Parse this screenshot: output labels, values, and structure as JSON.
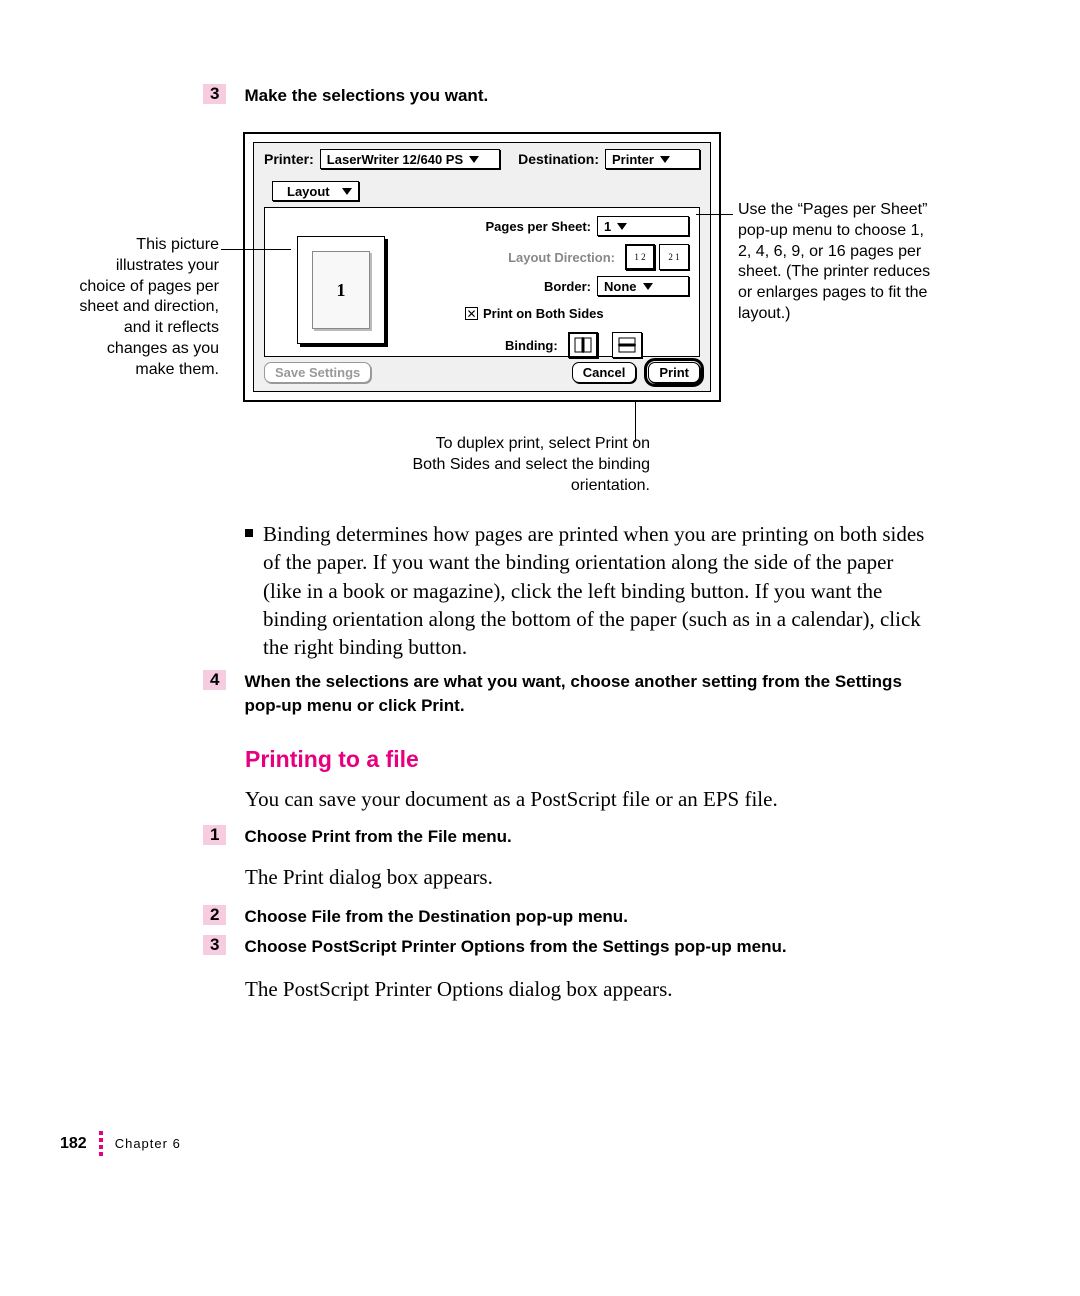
{
  "doc": {
    "page_number": "182",
    "chapter": "Chapter 6"
  },
  "steps_before": {
    "s3_num": "3",
    "s3_text": "Make the selections you want."
  },
  "dialog": {
    "printer_label": "Printer:",
    "printer_value": "LaserWriter 12/640 PS",
    "destination_label": "Destination:",
    "destination_value": "Printer",
    "tab": "Layout",
    "pps_label": "Pages per Sheet:",
    "pps_value": "1",
    "ld_label": "Layout Direction:",
    "ld_opt1": "1 2",
    "ld_opt2": "2 1",
    "border_label": "Border:",
    "border_value": "None",
    "both_label": "Print on Both Sides",
    "binding_label": "Binding:",
    "preview_text": "1",
    "save_btn": "Save Settings",
    "cancel_btn": "Cancel",
    "print_btn": "Print"
  },
  "callouts": {
    "left": "This picture illustrates your choice of pages per sheet and direction, and it reflects changes as you make them.",
    "right": "Use the “Pages per Sheet” pop-up menu to choose 1, 2, 4, 6, 9, or 16 pages per sheet. (The printer reduces or enlarges pages to fit the layout.)",
    "bottom": "To duplex print, select Print on Both Sides and select the binding orientation."
  },
  "body": {
    "binding_para": "Binding determines how pages are printed when you are printing on both sides of the paper. If you want the binding orientation along the side of the paper (like in a book or magazine), click the left binding button. If you want the binding orientation along the bottom of the paper (such as in a calendar), click the right binding button.",
    "s4_num": "4",
    "s4_text": "When the selections are what you want, choose another setting from the Settings pop-up menu or click Print.",
    "heading": "Printing to a file",
    "intro2": "You can save your document as a PostScript file or an EPS file.",
    "f1_num": "1",
    "f1_text": "Choose Print from the File menu.",
    "f1_after": "The Print dialog box appears.",
    "f2_num": "2",
    "f2_text": "Choose File from the Destination pop-up menu.",
    "f3_num": "3",
    "f3_text": "Choose PostScript Printer Options from the Settings pop-up menu.",
    "f3_after": "The PostScript Printer Options dialog box appears."
  }
}
